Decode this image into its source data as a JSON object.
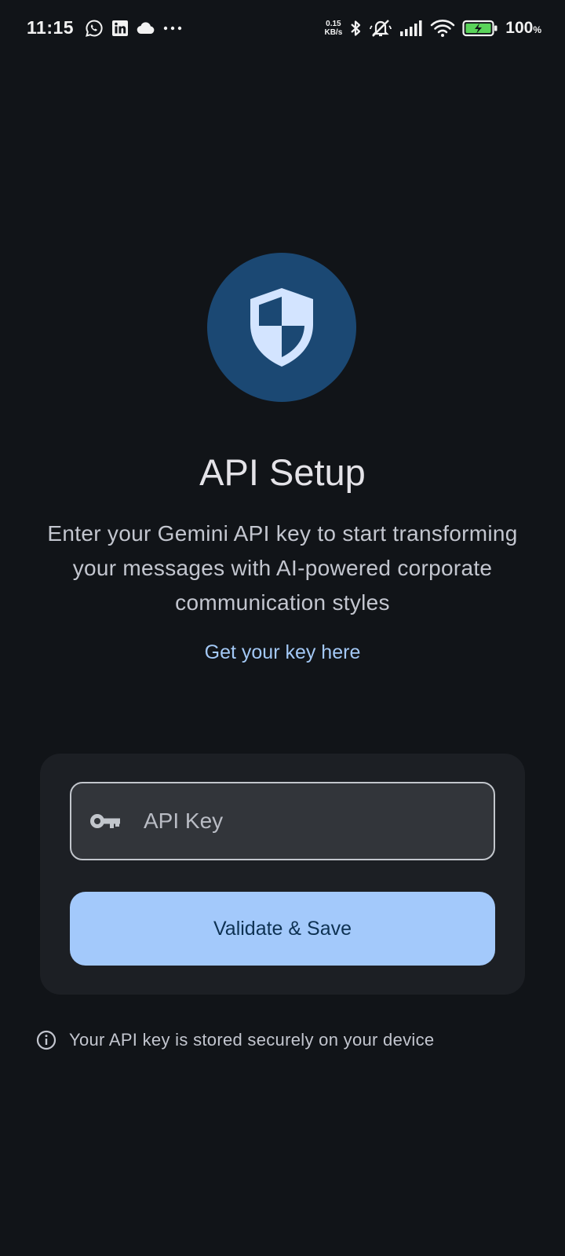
{
  "status_bar": {
    "time": "11:15",
    "left_icons": [
      "whatsapp-icon",
      "linkedin-icon",
      "cloud-icon",
      "more-dots-icon"
    ],
    "net_speed_value": "0.15",
    "net_speed_unit": "KB/s",
    "right_icons": [
      "bluetooth-icon",
      "silent-mode-icon",
      "signal-icon",
      "wifi-icon",
      "battery-charging-icon"
    ],
    "battery_percent": "100",
    "battery_percent_symbol": "%"
  },
  "hero": {
    "icon": "shield-icon",
    "icon_bg_color": "#1b4873",
    "icon_fg_color": "#d3e4ff"
  },
  "title": "API Setup",
  "description": "Enter your Gemini API key to start transforming your messages with AI-powered corporate communication styles",
  "link": {
    "label": "Get your key here",
    "color": "#a3c8f5"
  },
  "form": {
    "field_icon": "key-icon",
    "api_key_placeholder": "API Key",
    "api_key_value": "",
    "submit_label": "Validate & Save",
    "submit_color": "#a3c9fb"
  },
  "footer": {
    "icon": "info-icon",
    "note": "Your API key is stored securely on your device"
  },
  "colors": {
    "background": "#111418",
    "card": "#1c1f24"
  }
}
